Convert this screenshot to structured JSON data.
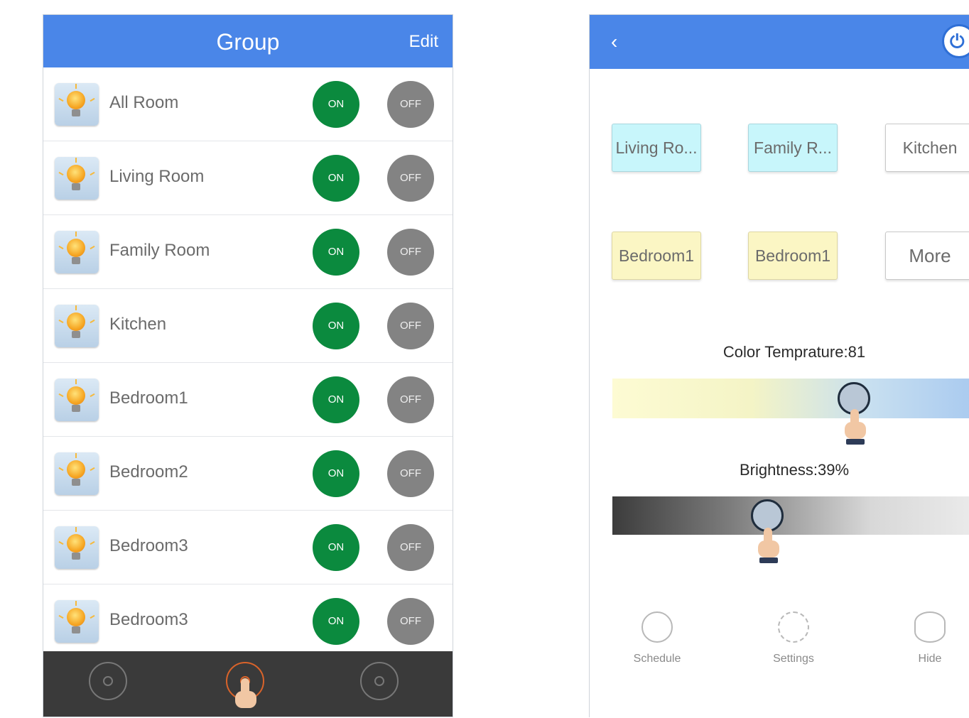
{
  "left_screen": {
    "header": {
      "title": "Group",
      "edit_label": "Edit"
    },
    "groups": [
      {
        "name": "All Room",
        "on_label": "ON",
        "off_label": "OFF"
      },
      {
        "name": "Living Room",
        "on_label": "ON",
        "off_label": "OFF"
      },
      {
        "name": "Family Room",
        "on_label": "ON",
        "off_label": "OFF"
      },
      {
        "name": "Kitchen",
        "on_label": "ON",
        "off_label": "OFF"
      },
      {
        "name": "Bedroom1",
        "on_label": "ON",
        "off_label": "OFF"
      },
      {
        "name": "Bedroom2",
        "on_label": "ON",
        "off_label": "OFF"
      },
      {
        "name": "Bedroom3",
        "on_label": "ON",
        "off_label": "OFF"
      },
      {
        "name": "Bedroom3",
        "on_label": "ON",
        "off_label": "OFF"
      }
    ],
    "bottom_nav": [
      {
        "icon": "bulb-icon",
        "active": false
      },
      {
        "icon": "group-icon",
        "active": true
      },
      {
        "icon": "settings-icon",
        "active": false
      }
    ],
    "colors": {
      "header": "#4a86e8",
      "on": "#0b8a3e",
      "off": "#838383",
      "nav": "#3a3a3a",
      "nav_active": "#d9632a"
    }
  },
  "right_screen": {
    "header": {
      "back_glyph": "‹",
      "power_icon": "power-icon"
    },
    "rooms": [
      {
        "label": "Living Ro...",
        "color": "cyan"
      },
      {
        "label": "Family R...",
        "color": "cyan"
      },
      {
        "label": "Kitchen",
        "color": "white"
      },
      {
        "label": "Bedroom1",
        "color": "yellow"
      },
      {
        "label": "Bedroom1",
        "color": "yellow"
      },
      {
        "label": "More",
        "color": "white"
      }
    ],
    "color_temperature": {
      "label": "Color Temprature:81",
      "value": 81
    },
    "brightness": {
      "label": "Brightness:39%",
      "value": 39
    },
    "tools": [
      {
        "label": "Schedule",
        "icon": "clock-icon"
      },
      {
        "label": "Settings",
        "icon": "gear-icon"
      },
      {
        "label": "Hide",
        "icon": "eye-icon"
      }
    ]
  }
}
